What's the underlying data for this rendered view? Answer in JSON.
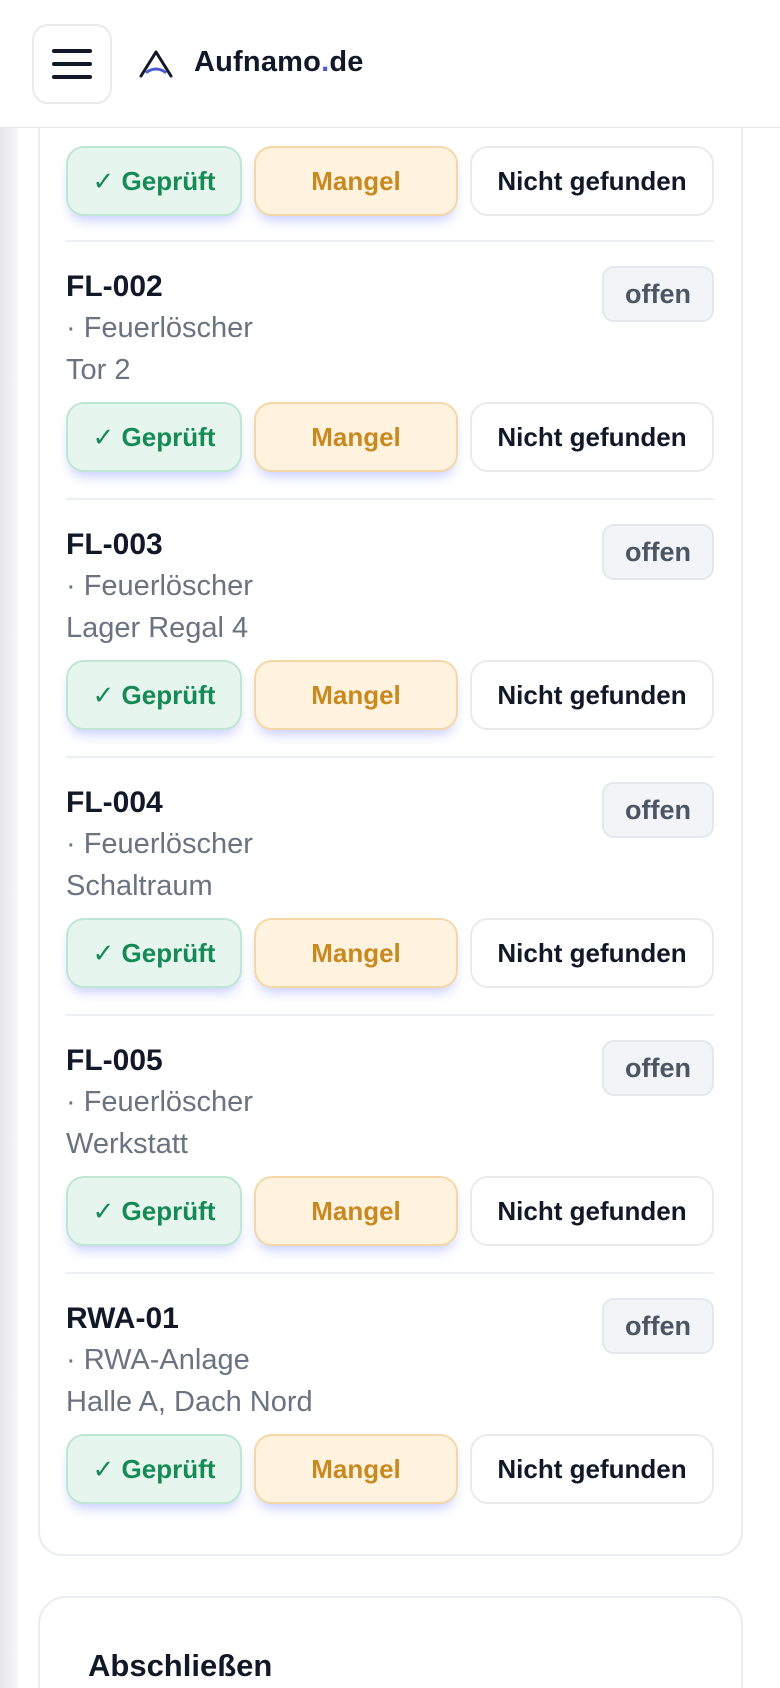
{
  "header": {
    "brand_main": "Aufnamo",
    "brand_dot": ".",
    "brand_tld": "de",
    "menu_icon": "hamburger-menu-icon",
    "logo_icon": "aufnamo-logo-icon"
  },
  "actions": {
    "ok_label": "✓ Geprüft",
    "defect_label": "Mangel",
    "not_found_label": "Nicht gefunden"
  },
  "items": [
    {
      "code": "FL-002",
      "type": "· Feuerlöscher",
      "location": "Tor 2",
      "status": "offen"
    },
    {
      "code": "FL-003",
      "type": "· Feuerlöscher",
      "location": "Lager Regal 4",
      "status": "offen"
    },
    {
      "code": "FL-004",
      "type": "· Feuerlöscher",
      "location": "Schaltraum",
      "status": "offen"
    },
    {
      "code": "FL-005",
      "type": "· Feuerlöscher",
      "location": "Werkstatt",
      "status": "offen"
    },
    {
      "code": "RWA-01",
      "type": "· RWA-Anlage",
      "location": "Halle A, Dach Nord",
      "status": "offen"
    }
  ],
  "finish_section": {
    "title": "Abschließen"
  },
  "colors": {
    "ok_green": "#168a55",
    "defect_orange": "#c8891f",
    "accent_blue": "#4a5ad8"
  }
}
